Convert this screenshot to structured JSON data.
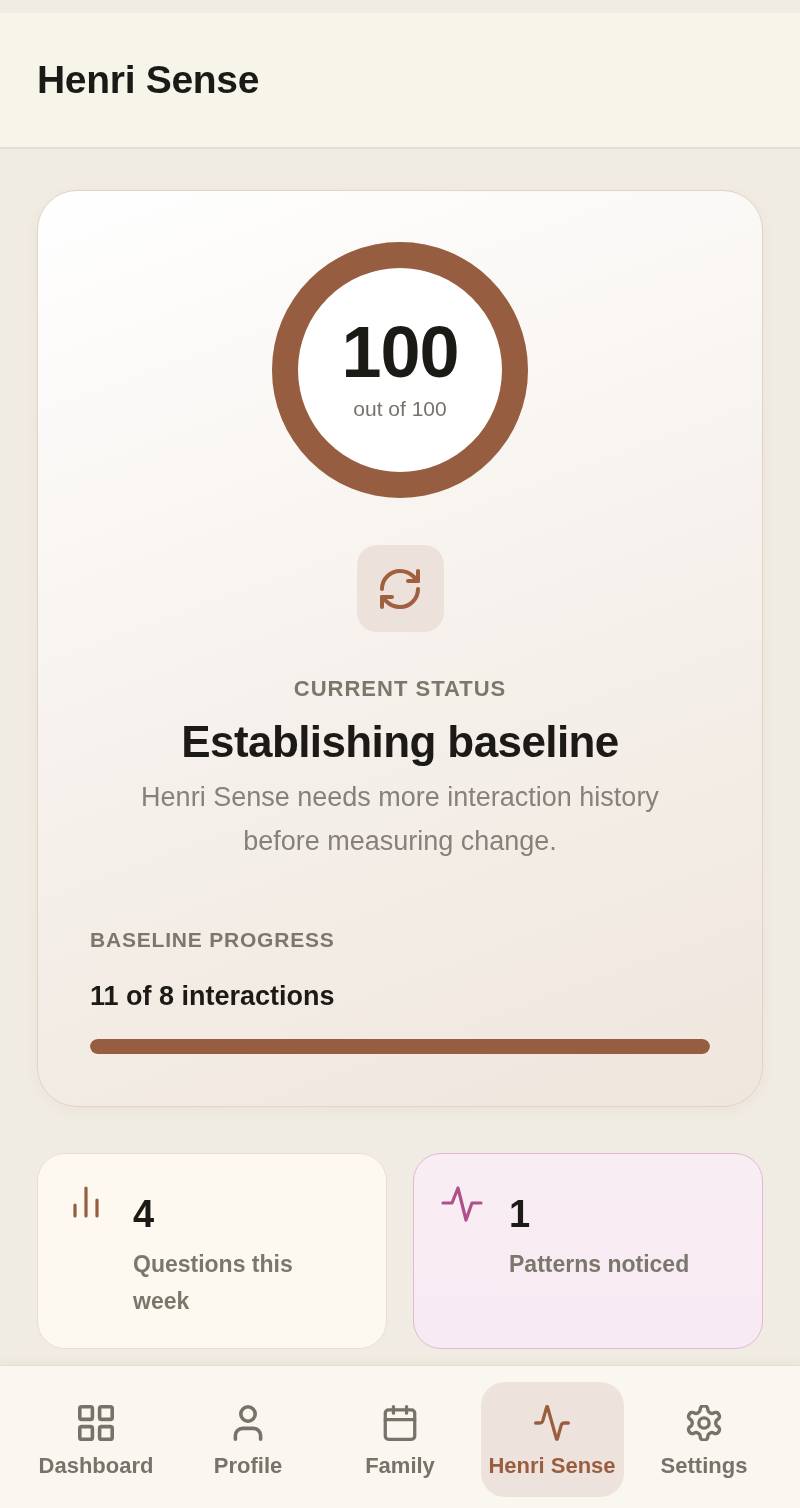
{
  "header": {
    "title": "Henri Sense"
  },
  "score": {
    "value": "100",
    "caption": "out of 100",
    "level": 1
  },
  "status": {
    "label": "CURRENT STATUS",
    "title": "Establishing baseline",
    "description": "Henri Sense needs more interaction history before measuring change."
  },
  "progress": {
    "label": "BASELINE PROGRESS",
    "value": "11 of 8 interactions",
    "level": 1
  },
  "stats": [
    {
      "value": "4",
      "label": "Questions this week",
      "color": "#975d40"
    },
    {
      "value": "1",
      "label": "Patterns noticed",
      "color": "#b04f8c"
    }
  ],
  "nav": [
    {
      "label": "Dashboard",
      "selected": false
    },
    {
      "label": "Profile",
      "selected": false
    },
    {
      "label": "Family",
      "selected": false
    },
    {
      "label": "Henri Sense",
      "selected": true
    },
    {
      "label": "Settings",
      "selected": false
    }
  ]
}
